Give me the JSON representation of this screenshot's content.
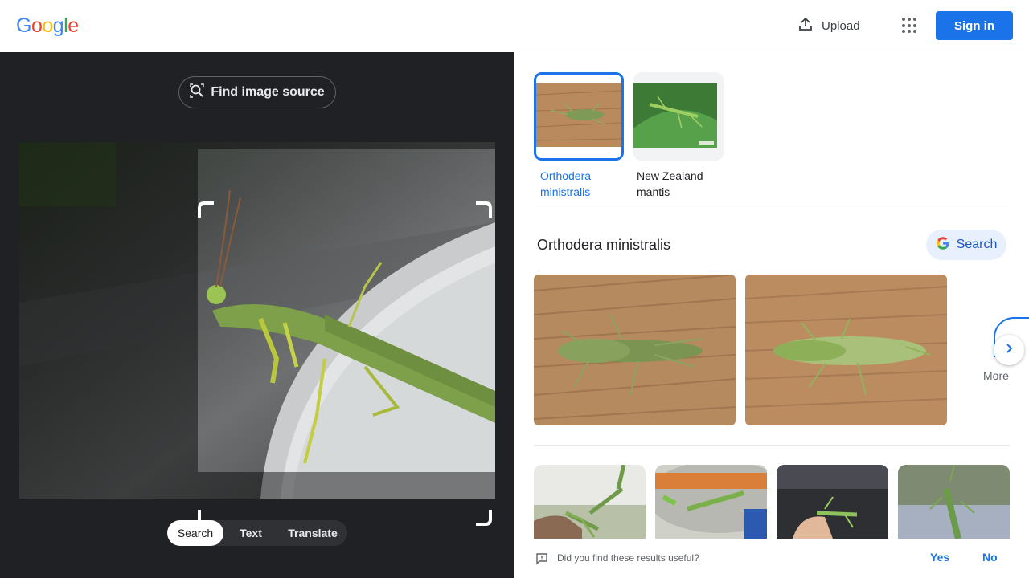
{
  "header": {
    "logo_letters": [
      "G",
      "o",
      "o",
      "g",
      "l",
      "e"
    ],
    "logo_colors": [
      "#4285f4",
      "#ea4335",
      "#fbbc05",
      "#4285f4",
      "#34a853",
      "#ea4335"
    ],
    "upload_label": "Upload",
    "signin_label": "Sign in"
  },
  "lens": {
    "find_source_label": "Find image source",
    "modes": [
      "Search",
      "Text",
      "Translate"
    ],
    "active_mode": "Search"
  },
  "results": {
    "chips": [
      {
        "label": "Orthodera ministralis",
        "selected": true
      },
      {
        "label": "New Zealand mantis",
        "selected": false
      }
    ],
    "entity_title": "Orthodera ministralis",
    "search_label": "Search",
    "more_label": "More"
  },
  "feedback": {
    "question": "Did you find these results useful?",
    "yes": "Yes",
    "no": "No"
  },
  "colors": {
    "accent": "#1a73e8",
    "dark_panel": "#202124"
  }
}
